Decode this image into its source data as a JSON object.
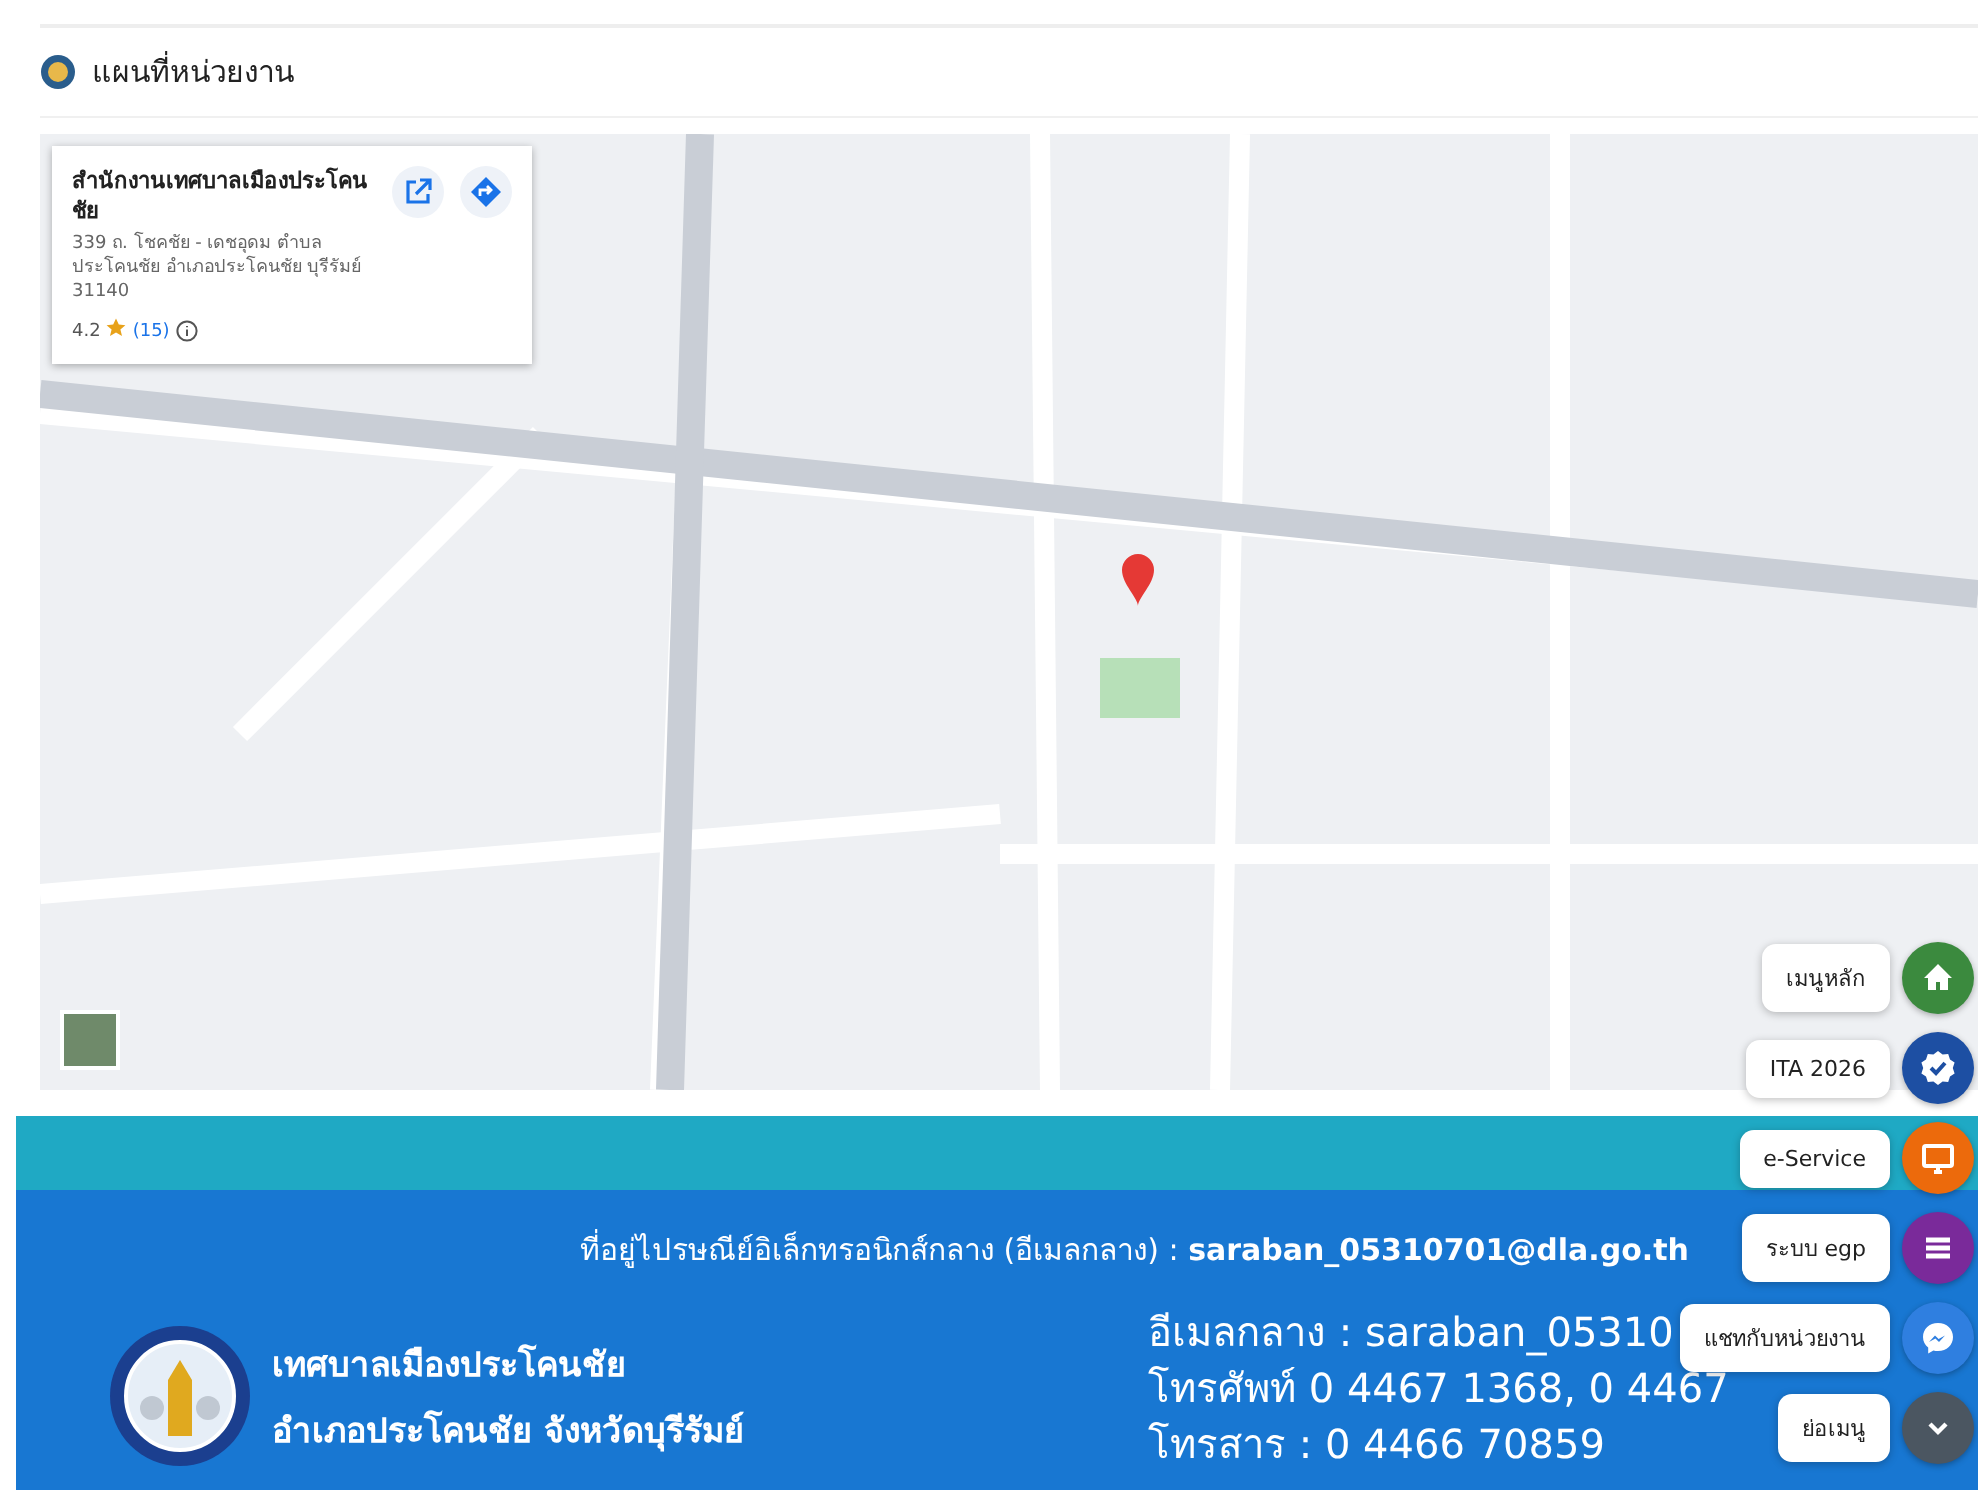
{
  "section": {
    "title": "แผนที่หน่วยงาน"
  },
  "place_card": {
    "name": "สำนักงานเทศบาลเมืองประโคนชัย",
    "address": "339 ถ. โชคชัย - เดชอุดม ตำบล ประโคนชัย อำเภอประโคนชัย บุรีรัมย์ 31140",
    "rating": "4.2",
    "reviews": "(15)"
  },
  "footer": {
    "email_label": "ที่อยู่ไปรษณีย์อิเล็กทรอนิกส์กลาง (อีเมลกลาง) : ",
    "email": "saraban_05310701@dla.go.th",
    "org_name": "เทศบาลเมืองประโคนชัย",
    "org_district": "อำเภอประโคนชัย จังหวัดบุรีรัมย์",
    "contacts": [
      "อีเมลกลาง : saraban_05310",
      "โทรศัพท์ 0 4467 1368, 0 4467",
      "โทรสาร : 0 4466 70859"
    ]
  },
  "quick_menu": [
    {
      "label": "เมนูหลัก",
      "kind": "home",
      "color": "#3b8a3e"
    },
    {
      "label": "ITA 2026",
      "kind": "badge",
      "color": "#1d4fa3"
    },
    {
      "label": "e-Service",
      "kind": "monitor",
      "color": "#ec6a0c"
    },
    {
      "label": "ระบบ egp",
      "kind": "list",
      "color": "#7a2a9a"
    },
    {
      "label": "แชทกับหน่วยงาน",
      "kind": "chat",
      "color": "#2f7fe0"
    },
    {
      "label": "ย่อเมนู",
      "kind": "collapse",
      "color": "#4b5661"
    }
  ]
}
